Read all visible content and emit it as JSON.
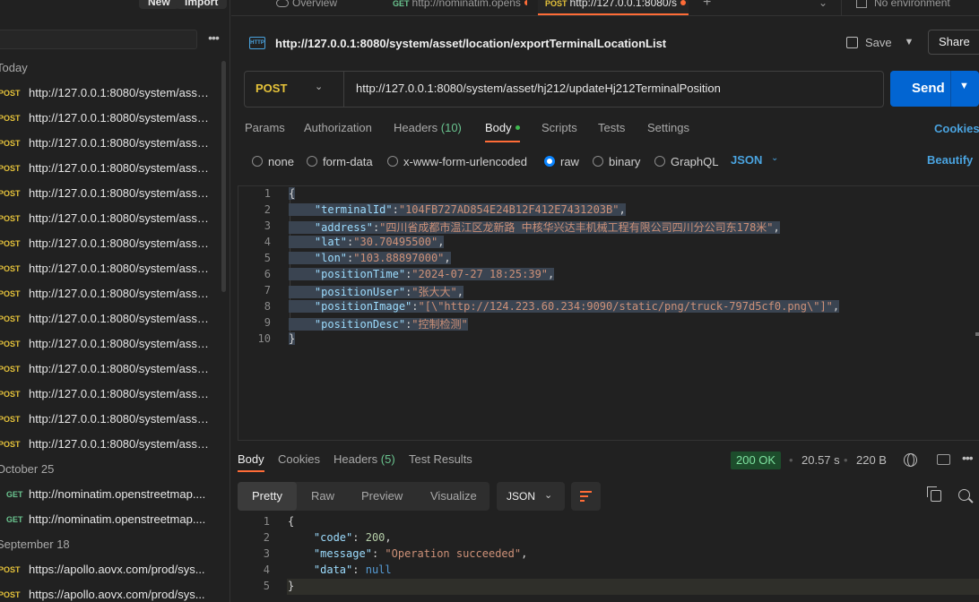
{
  "sidebar": {
    "new_label": "New",
    "import_label": "Import",
    "more_label": "•••",
    "groups": [
      {
        "label": "Today",
        "items": [
          {
            "method": "POST",
            "url": "http://127.0.0.1:8080/system/asse..."
          },
          {
            "method": "POST",
            "url": "http://127.0.0.1:8080/system/asse..."
          },
          {
            "method": "POST",
            "url": "http://127.0.0.1:8080/system/asse..."
          },
          {
            "method": "POST",
            "url": "http://127.0.0.1:8080/system/asse..."
          },
          {
            "method": "POST",
            "url": "http://127.0.0.1:8080/system/asse..."
          },
          {
            "method": "POST",
            "url": "http://127.0.0.1:8080/system/asse..."
          },
          {
            "method": "POST",
            "url": "http://127.0.0.1:8080/system/asse..."
          },
          {
            "method": "POST",
            "url": "http://127.0.0.1:8080/system/asse..."
          },
          {
            "method": "POST",
            "url": "http://127.0.0.1:8080/system/asse..."
          },
          {
            "method": "POST",
            "url": "http://127.0.0.1:8080/system/asse..."
          },
          {
            "method": "POST",
            "url": "http://127.0.0.1:8080/system/asse..."
          },
          {
            "method": "POST",
            "url": "http://127.0.0.1:8080/system/asse..."
          },
          {
            "method": "POST",
            "url": "http://127.0.0.1:8080/system/asse..."
          },
          {
            "method": "POST",
            "url": "http://127.0.0.1:8080/system/asse..."
          },
          {
            "method": "POST",
            "url": "http://127.0.0.1:8080/system/asse..."
          }
        ]
      },
      {
        "label": "October 25",
        "items": [
          {
            "method": "GET",
            "url": "http://nominatim.openstreetmap...."
          },
          {
            "method": "GET",
            "url": "http://nominatim.openstreetmap...."
          }
        ]
      },
      {
        "label": "September 18",
        "items": [
          {
            "method": "POST",
            "url": "https://apollo.aovx.com/prod/sys..."
          },
          {
            "method": "POST",
            "url": "https://apollo.aovx.com/prod/sys..."
          }
        ]
      }
    ]
  },
  "tabs": {
    "overview": "Overview",
    "tab2_method": "GET",
    "tab2_label": "http://nominatim.opens",
    "tab3_method": "POST",
    "tab3_label": "http://127.0.0.1:8080/s",
    "add": "+",
    "caret": "⌄",
    "environment": "No environment"
  },
  "request": {
    "title": "http://127.0.0.1:8080/system/asset/location/exportTerminalLocationList",
    "save_label": "Save",
    "share_label": "Share",
    "method": "POST",
    "url": "http://127.0.0.1:8080/system/asset/hj212/updateHj212TerminalPosition",
    "send_label": "Send",
    "tabs": [
      "Params",
      "Authorization",
      "Headers",
      "Body",
      "Scripts",
      "Tests",
      "Settings"
    ],
    "headers_count": "(10)",
    "cookies_label": "Cookies",
    "body_types": [
      "none",
      "form-data",
      "x-www-form-urlencoded",
      "raw",
      "binary",
      "GraphQL"
    ],
    "body_format": "JSON",
    "beautify_label": "Beautify",
    "body_lines": [
      {
        "n": "1",
        "text": "{"
      },
      {
        "n": "2",
        "key": "\"terminalId\"",
        "val": "\"104FB727AD854E24B12F412E7431203B\"",
        "tail": ","
      },
      {
        "n": "3",
        "key": "\"address\"",
        "val": "\"四川省成都市温江区龙新路 中核华兴达丰机械工程有限公司四川分公司东178米\"",
        "tail": ","
      },
      {
        "n": "4",
        "key": "\"lat\"",
        "val": "\"30.70495500\"",
        "tail": ","
      },
      {
        "n": "5",
        "key": "\"lon\"",
        "val": "\"103.88897000\"",
        "tail": ","
      },
      {
        "n": "6",
        "key": "\"positionTime\"",
        "val": "\"2024-07-27 18:25:39\"",
        "tail": ","
      },
      {
        "n": "7",
        "key": "\"positionUser\"",
        "val": "\"张大大\"",
        "tail": ","
      },
      {
        "n": "8",
        "key": "\"positionImage\"",
        "val": "\"[\\\"http://124.223.60.234:9090/static/png/truck-797d5cf0.png\\\"]\"",
        "tail": ","
      },
      {
        "n": "9",
        "key": "\"positionDesc\"",
        "val": "\"控制检测\"",
        "tail": ""
      },
      {
        "n": "10",
        "text": "}"
      }
    ]
  },
  "response": {
    "tabs": [
      "Body",
      "Cookies",
      "Headers",
      "Test Results"
    ],
    "headers_count": "(5)",
    "status": "200 OK",
    "time": "20.57 s",
    "size": "220 B",
    "views": [
      "Pretty",
      "Raw",
      "Preview",
      "Visualize"
    ],
    "format": "JSON",
    "lines": [
      {
        "n": "1",
        "text": "{"
      },
      {
        "n": "2",
        "key": "\"code\"",
        "num": "200",
        "tail": ","
      },
      {
        "n": "3",
        "key": "\"message\"",
        "val": "\"Operation succeeded\"",
        "tail": ","
      },
      {
        "n": "4",
        "key": "\"data\"",
        "kw": "null",
        "tail": ""
      },
      {
        "n": "5",
        "text": "}"
      }
    ]
  },
  "colors": {
    "accent": "#ff6c37",
    "send": "#0265d2",
    "post": "#e6c33a",
    "get": "#6ac48f",
    "link": "#4aa3df",
    "status_ok": "#7ee2a0"
  }
}
